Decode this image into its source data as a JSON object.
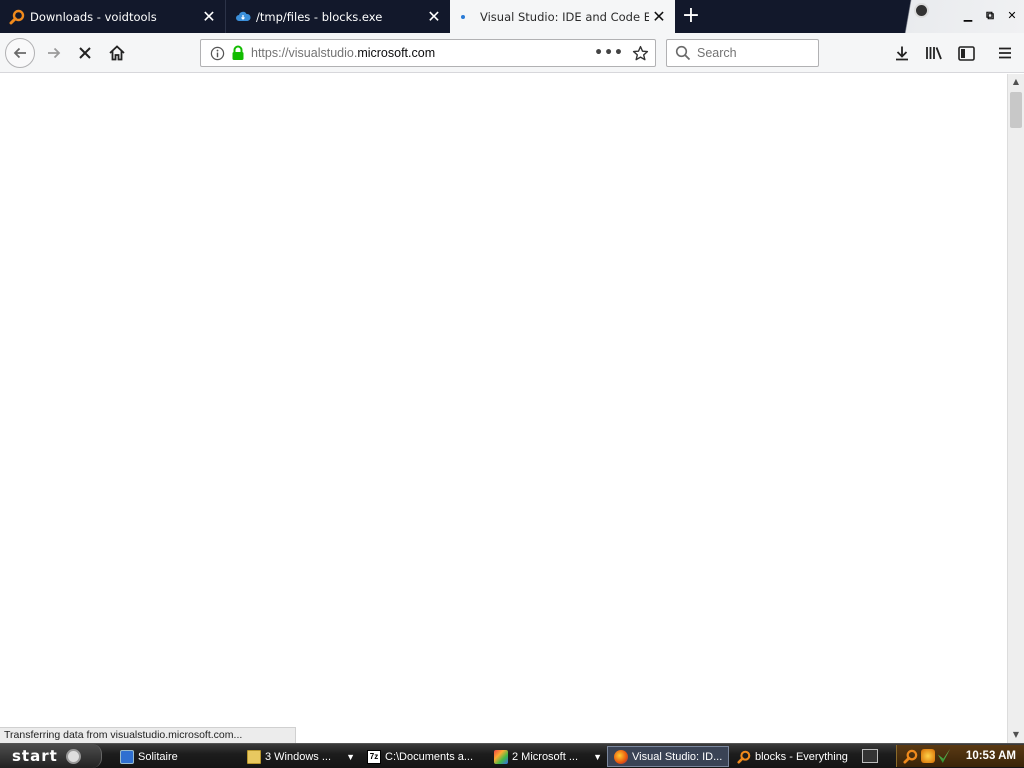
{
  "tabs": [
    {
      "title": "Downloads - voidtools",
      "icon": "magnifier-icon",
      "active": false
    },
    {
      "title": "/tmp/files - blocks.exe",
      "icon": "cloud-icon",
      "active": false
    },
    {
      "title": "Visual Studio: IDE and Code Editor",
      "icon": "loading-dot-icon",
      "active": true
    }
  ],
  "navbar": {
    "url_prefix": "https://visualstudio.",
    "url_domain": "microsoft.com",
    "search_placeholder": "Search"
  },
  "status_text": "Transferring data from visualstudio.microsoft.com...",
  "taskbar": {
    "start_label": "start",
    "items": [
      {
        "label": "Solitaire",
        "icon": "solitaire-icon",
        "active": false
      },
      {
        "label": "3 Windows ...",
        "icon": "folder-icon",
        "active": false,
        "grouped": true
      },
      {
        "label": "C:\\Documents a...",
        "icon": "7zip-icon",
        "active": false
      },
      {
        "label": "2 Microsoft ...",
        "icon": "app-icon",
        "active": false,
        "grouped": true
      },
      {
        "label": "Visual Studio: ID...",
        "icon": "firefox-icon",
        "active": true
      },
      {
        "label": "blocks - Everything",
        "icon": "magnifier-icon",
        "active": false
      }
    ],
    "clock": "10:53 AM"
  },
  "colors": {
    "tabbar_bg": "#12182b",
    "accent_orange": "#e8780c",
    "lock_green": "#12bc00",
    "taskbar_bg": "#1d1d1d"
  }
}
